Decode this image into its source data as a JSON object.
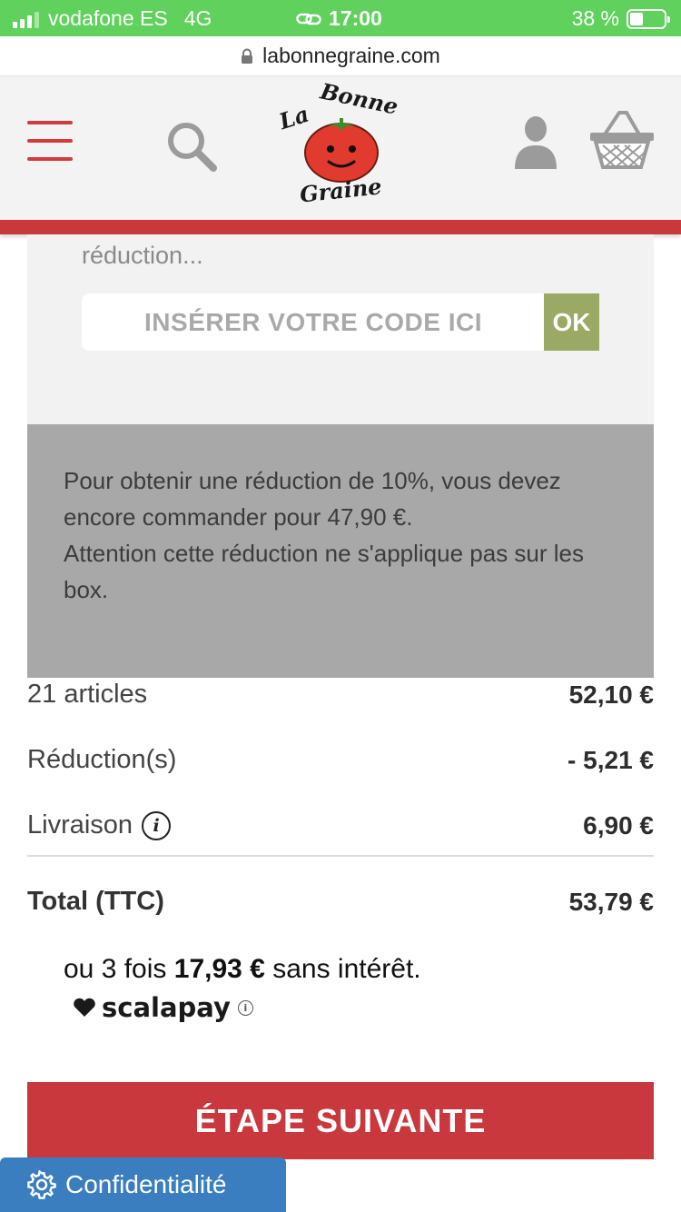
{
  "status_bar": {
    "carrier": "vodafone ES",
    "network": "4G",
    "time": "17:00",
    "battery": "38 %",
    "battery_level": 0.38
  },
  "browser": {
    "url": "labonnegraine.com"
  },
  "header": {
    "logo_text": "La Bonne Graine",
    "icons": [
      "menu-icon",
      "search-icon",
      "user-icon",
      "basket-icon"
    ]
  },
  "voucher": {
    "hint": "réduction...",
    "placeholder": "INSÉRER VOTRE CODE ICI",
    "ok_label": "OK"
  },
  "info_message": {
    "line1": "Pour obtenir une réduction de 10%, vous devez encore commander pour 47,90 €.",
    "line2": "Attention cette réduction ne s'applique pas sur les box."
  },
  "summary": {
    "articles_label": "21 articles",
    "articles_value": "52,10 €",
    "discount_label": "Réduction(s)",
    "discount_value": "- 5,21 €",
    "shipping_label": "Livraison",
    "shipping_value": "6,90 €",
    "total_label": "Total (TTC)",
    "total_value": "53,79 €"
  },
  "scalapay": {
    "prefix": "ou 3 fois",
    "amount": "17,93 €",
    "suffix": "sans intérêt.",
    "brand": "scalapay"
  },
  "actions": {
    "next_step": "ÉTAPE SUIVANTE",
    "privacy": "Confidentialité"
  },
  "colors": {
    "status_green": "#5fd15c",
    "brand_red": "#c8383c",
    "ok_green": "#9aa964",
    "privacy_blue": "#3a7ec0",
    "info_grey": "#a8a8a8"
  }
}
